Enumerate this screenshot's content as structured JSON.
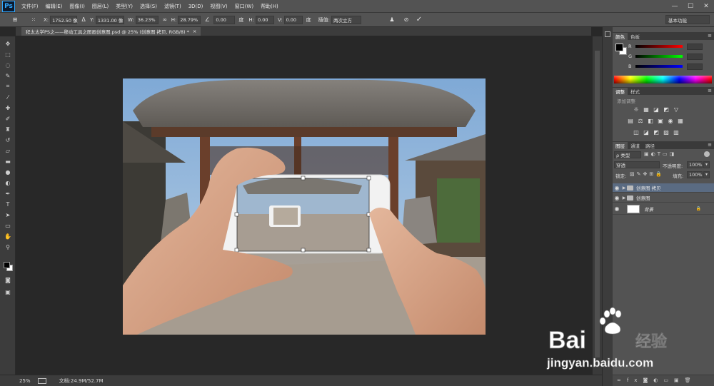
{
  "app": {
    "logo": "Ps"
  },
  "menu": [
    "文件(F)",
    "编辑(E)",
    "图像(I)",
    "图层(L)",
    "类型(Y)",
    "选择(S)",
    "滤镜(T)",
    "3D(D)",
    "视图(V)",
    "窗口(W)",
    "帮助(H)"
  ],
  "window_controls": {
    "minimize": "—",
    "maximize": "☐",
    "close": "✕"
  },
  "options": {
    "x_label": "X:",
    "x_value": "1752.50 像",
    "y_label": "Y:",
    "y_value": "1331.00 像",
    "w_label": "W:",
    "w_value": "36.23%",
    "h_label": "H:",
    "h_value": "28.79%",
    "angle_value": "0.00",
    "angle_unit": "度",
    "hskew_label": "H:",
    "hskew_value": "0.00",
    "vskew_label": "V:",
    "vskew_value": "0.00",
    "degree_unit": "度",
    "interp_label": "插值:",
    "interp_value": "两次立方",
    "workspace": "基本功能"
  },
  "document": {
    "tab_title": "程太太学PS之——移动工具之图画创意图.psd @ 25% (创意图 拷贝, RGB/8) *",
    "tab_close": "×",
    "zoom": "25%",
    "info": "文档:24.9M/52.7M"
  },
  "colors": {
    "foreground": "#000000",
    "background": "#ffffff",
    "accent": "#31a8ff",
    "panel_bg": "#535353",
    "selected_layer": "#5a6b82"
  },
  "color_panel": {
    "tabs": [
      "颜色",
      "色板"
    ],
    "sliders": [
      {
        "label": "R",
        "color": "#ff0000"
      },
      {
        "label": "G",
        "color": "#00ff00"
      },
      {
        "label": "B",
        "color": "#0000ff"
      }
    ]
  },
  "adjust_panel": {
    "tabs": [
      "调整",
      "样式"
    ],
    "header": "添加调整",
    "row1": [
      "☼",
      "▦",
      "◪",
      "◩",
      "▽"
    ],
    "row2": [
      "▤",
      "⚖",
      "◧",
      "▣",
      "◉",
      "▦"
    ],
    "row3": [
      "◫",
      "◪",
      "◩",
      "▨",
      "▥"
    ]
  },
  "layers_panel": {
    "tabs": [
      "图层",
      "通道",
      "路径"
    ],
    "filter_type": "ρ 类型",
    "blend_mode": "穿透",
    "opacity_label": "不透明度:",
    "opacity_value": "100%",
    "lock_label": "锁定:",
    "fill_label": "填充:",
    "fill_value": "100%",
    "layers": [
      {
        "name": "创意图 拷贝",
        "type": "group",
        "selected": true
      },
      {
        "name": "创意图",
        "type": "group",
        "selected": false
      },
      {
        "name": "背景",
        "type": "background",
        "selected": false
      }
    ],
    "lock_icon": "🔒"
  },
  "watermark": {
    "brand": "Bai",
    "brand_cn": "经验",
    "url": "jingyan.baidu.com"
  }
}
